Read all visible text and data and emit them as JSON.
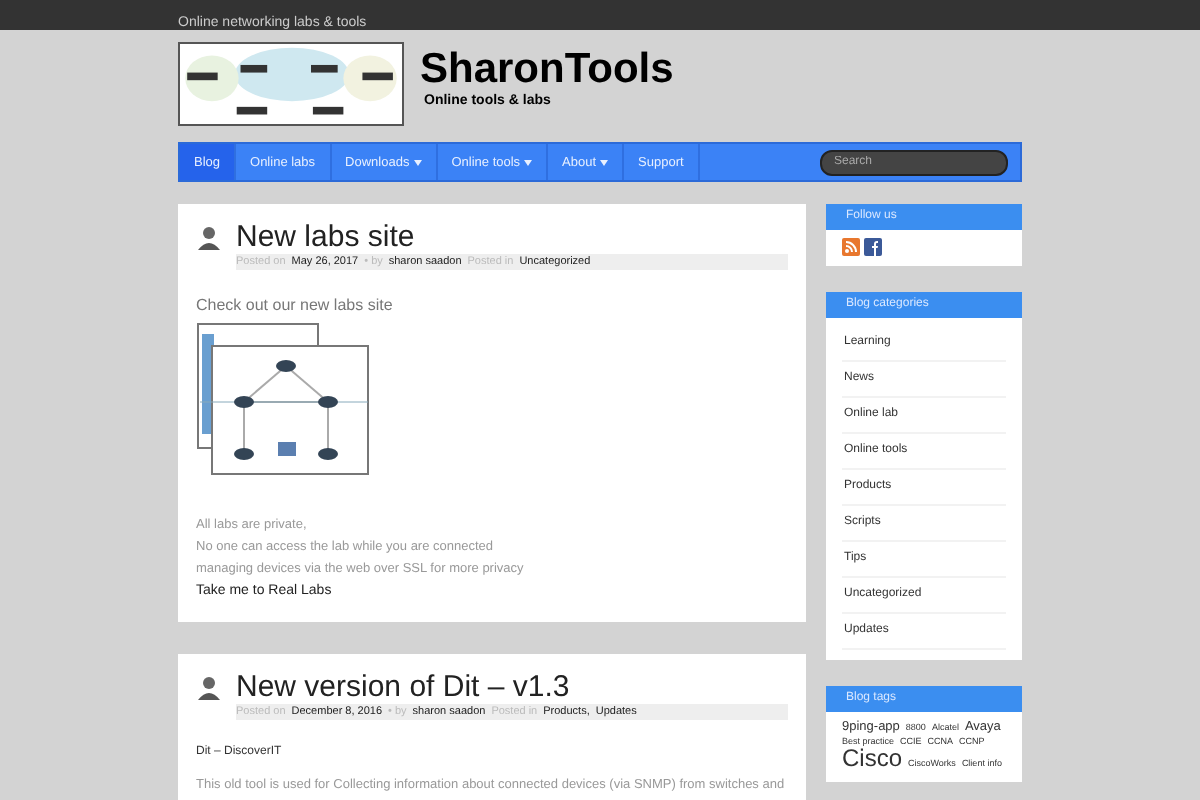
{
  "top_bar": {
    "tagline": "Online networking labs & tools"
  },
  "header": {
    "title": "SharonTools",
    "subtitle": "Online tools & labs"
  },
  "nav": {
    "items": [
      {
        "label": "Blog",
        "selected": true,
        "dropdown": false
      },
      {
        "label": "Online labs",
        "selected": false,
        "dropdown": false
      },
      {
        "label": "Downloads",
        "selected": false,
        "dropdown": true
      },
      {
        "label": "Online tools",
        "selected": false,
        "dropdown": true
      },
      {
        "label": "About",
        "selected": false,
        "dropdown": true
      },
      {
        "label": "Support",
        "selected": false,
        "dropdown": false
      }
    ],
    "search": {
      "placeholder": "Search"
    }
  },
  "posts": [
    {
      "title": "New labs site",
      "posted_on_label": "Posted on",
      "date": "May 26, 2017",
      "by_label": "• by",
      "author": "sharon saadon",
      "posted_in_label": "Posted in",
      "categories": [
        "Uncategorized"
      ],
      "content": [
        {
          "kind": "heading",
          "text": "Check out our new labs site"
        },
        {
          "kind": "diagram"
        },
        {
          "kind": "line",
          "text": "All labs are private,"
        },
        {
          "kind": "line",
          "text": "No one can access the lab while you are connected"
        },
        {
          "kind": "line",
          "text": "managing devices via the web over SSL for more privacy"
        },
        {
          "kind": "link",
          "text": "Take me to Real Labs"
        }
      ]
    },
    {
      "title": "New version of Dit – v1.3",
      "posted_on_label": "Posted on",
      "date": "December 8, 2016",
      "by_label": "• by",
      "author": "sharon saadon",
      "posted_in_label": "Posted in",
      "categories": [
        "Products",
        "Updates"
      ],
      "category_separator": ",",
      "content": [
        {
          "kind": "subheading",
          "text": "Dit – DiscoverIT"
        },
        {
          "kind": "line",
          "text": "This old tool is used for Collecting information about connected devices (via SNMP) from switches and"
        }
      ]
    }
  ],
  "sidebar": {
    "follow": {
      "title": "Follow us"
    },
    "categories": {
      "title": "Blog categories",
      "items": [
        "Learning",
        "News",
        "Online lab",
        "Online tools",
        "Products",
        "Scripts",
        "Tips",
        "Uncategorized",
        "Updates"
      ]
    },
    "tags": {
      "title": "Blog tags",
      "items": [
        {
          "label": "9ping-app",
          "kind": "medium"
        },
        {
          "label": "8800",
          "kind": "small"
        },
        {
          "label": "Alcatel",
          "kind": "small"
        },
        {
          "label": "Avaya",
          "kind": "medium"
        },
        {
          "label": "Best practice",
          "kind": "small"
        },
        {
          "label": "CCIE",
          "kind": "small"
        },
        {
          "label": "CCNA",
          "kind": "small"
        },
        {
          "label": "CCNP",
          "kind": "small"
        },
        {
          "label": "Cisco",
          "kind": "large"
        },
        {
          "label": "CiscoWorks",
          "kind": "small"
        },
        {
          "label": "Client info",
          "kind": "small"
        }
      ]
    }
  }
}
